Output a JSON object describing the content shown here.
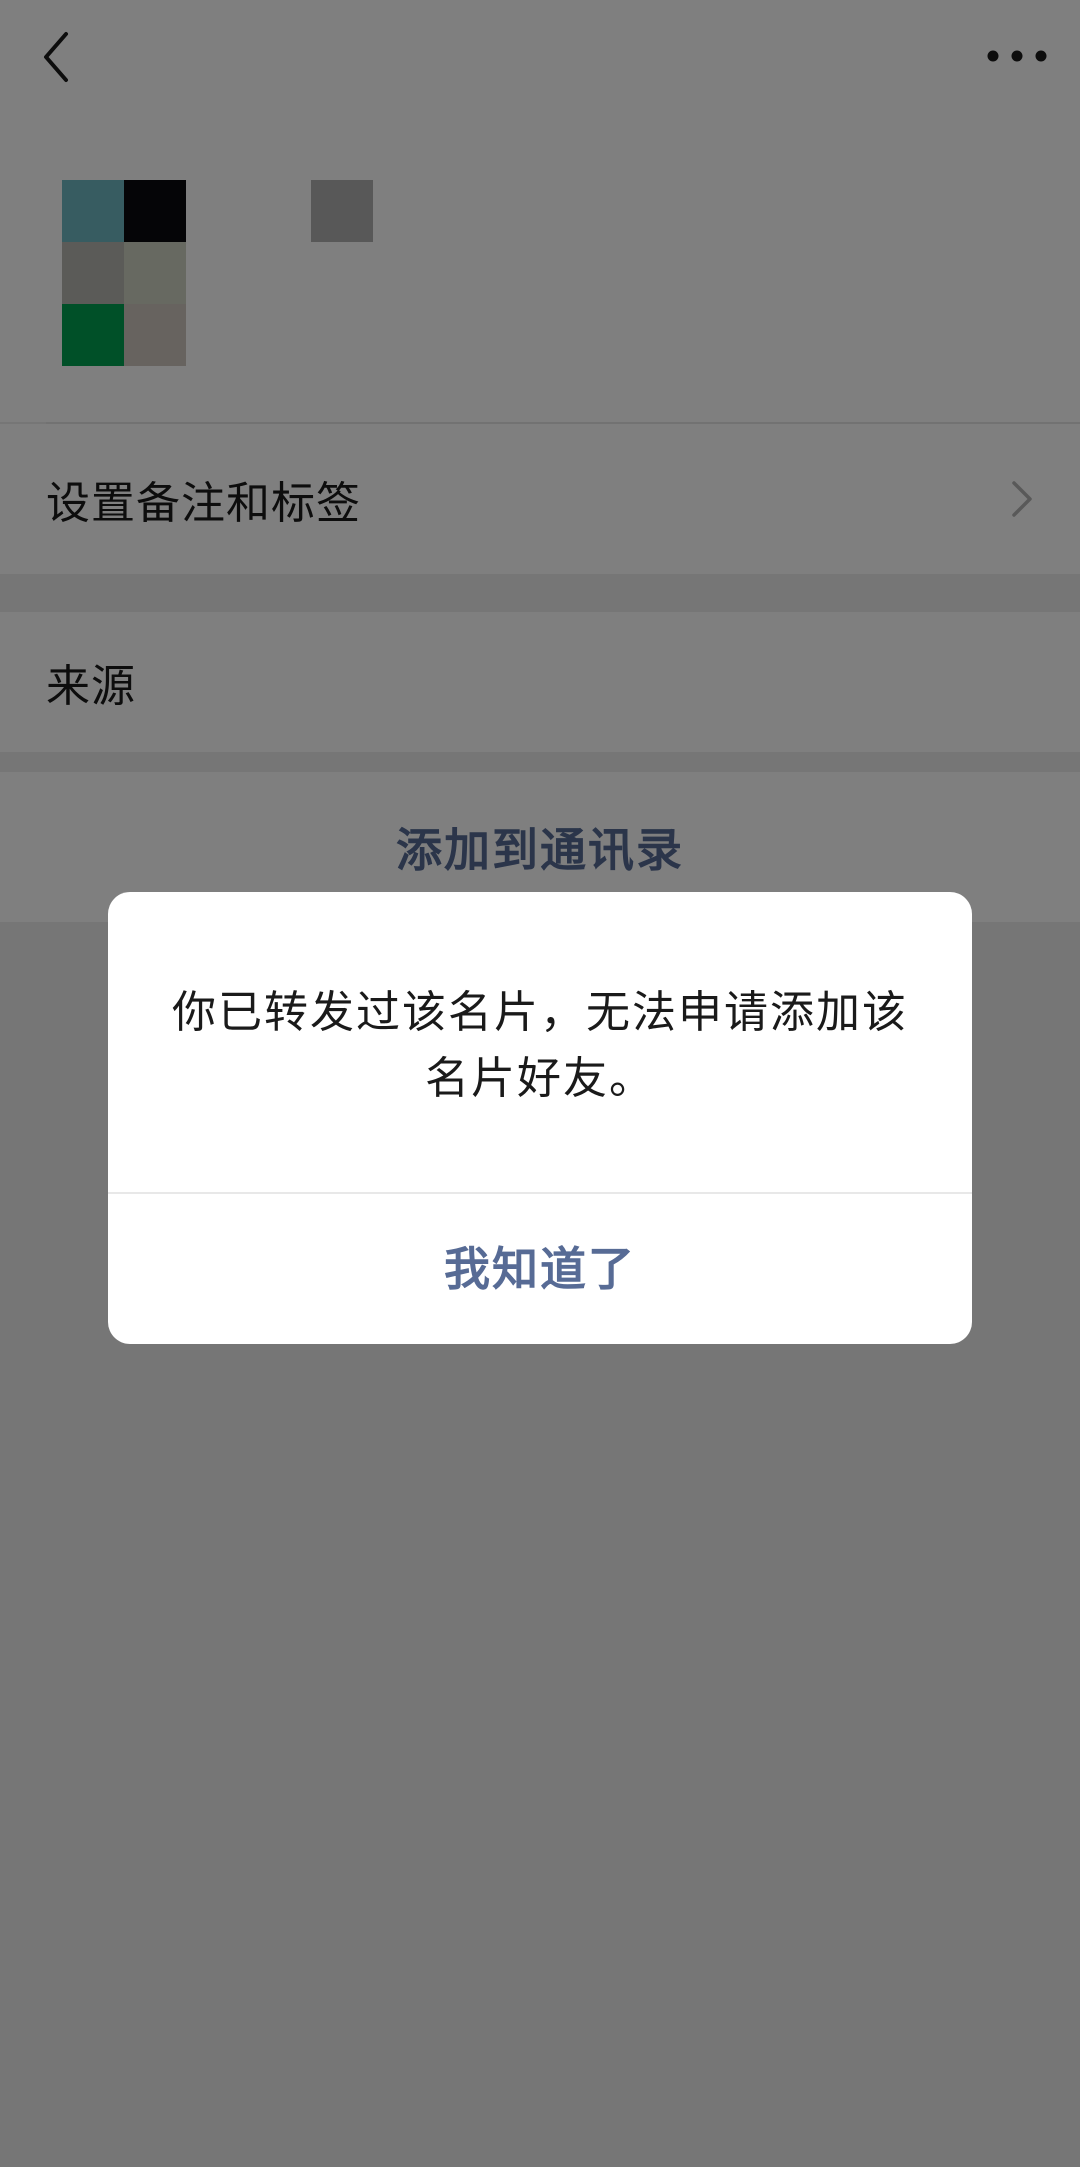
{
  "nav": {
    "back_icon": "chevron-left-icon",
    "more_icon": "more-horizontal-icon"
  },
  "profile": {
    "avatar_colors": [
      "#6fb8c2",
      "#0b0b0e",
      "#b6b6b0",
      "#cfd3c3",
      "#00a050",
      "#cfc6bf"
    ]
  },
  "rows": {
    "remark_label": "设置备注和标签",
    "source_label": "来源",
    "add_to_contacts_label": "添加到通讯录"
  },
  "dialog": {
    "message": "你已转发过该名片，无法申请添加该名片好友。",
    "confirm_label": "我知道了"
  },
  "colors": {
    "link": "#576b95",
    "overlay": "rgba(0,0,0,0.5)"
  }
}
